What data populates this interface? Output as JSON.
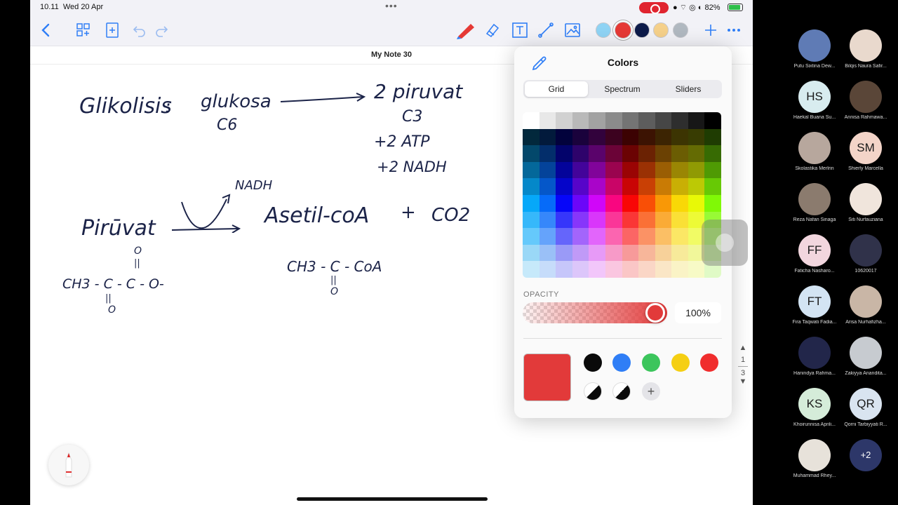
{
  "status_bar": {
    "time": "10.11",
    "date": "Wed 20 Apr",
    "battery": "82%"
  },
  "toolbar": {
    "left_icons": [
      "chevron-left-icon",
      "thumbnails-icon",
      "add-page-icon",
      "undo-icon",
      "redo-icon"
    ],
    "tool_icons": [
      "pen-icon",
      "eraser-icon",
      "text-icon",
      "lasso-icon",
      "image-icon"
    ],
    "pen_colors": [
      "#8fd3f4",
      "#e53935",
      "#0d1b4a",
      "#f5d08a",
      "#b0b8c0"
    ],
    "right_icons": [
      "plus-icon",
      "more-icon"
    ]
  },
  "note": {
    "title": "My Note 30",
    "handwriting": {
      "glikolisis": "Glikolisis",
      "colon": ":",
      "glukosa": "glukosa",
      "c6": "C6",
      "piruvat2": "2 piruvat",
      "c3": "C3",
      "atp": "+2 ATP",
      "nadh2": "+2 NADH",
      "nadh": "NADH",
      "piruvat": "Pirūvat",
      "asetil": "Asetil-coA",
      "plus": "+",
      "co2": "CO2",
      "formula_piruvat": "CH3 - C - C - O-",
      "formula_piruvat_o_top": "O",
      "formula_piruvat_o_bottom": "O",
      "formula_asetil": "CH3 - C - CoA",
      "formula_asetil_o": "O"
    }
  },
  "page_control": {
    "current": "1",
    "total": "3"
  },
  "colors_panel": {
    "title": "Colors",
    "tabs": [
      "Grid",
      "Spectrum",
      "Sliders"
    ],
    "active_tab": "Grid",
    "opacity_label": "OPACITY",
    "opacity_value": "100%",
    "current_color": "#e23a3a",
    "swatches": [
      "#0a0a0a",
      "#2f7ef6",
      "#3cc55c",
      "#f5cf13",
      "#f02d2d"
    ]
  },
  "participants": [
    {
      "name": "Putu Sixtina Dew...",
      "initials": "",
      "color": "#5f7bb5"
    },
    {
      "name": "Bilqis Naura Safir...",
      "initials": "",
      "color": "#e9d9cd"
    },
    {
      "name": "Haekal Buana Su...",
      "initials": "HS",
      "color": "#d8ecef"
    },
    {
      "name": "Annisa Rahmawa...",
      "initials": "",
      "color": "#5a4638"
    },
    {
      "name": "Skolastika Merlrin",
      "initials": "",
      "color": "#b7a79d"
    },
    {
      "name": "Shierly Marcella",
      "initials": "SM",
      "color": "#f3d4c8"
    },
    {
      "name": "Reza Nafan Sinaga",
      "initials": "",
      "color": "#8b7b6e"
    },
    {
      "name": "Siti Nurfauziana",
      "initials": "",
      "color": "#f0e5dc"
    },
    {
      "name": "Faticha Nasharo...",
      "initials": "FF",
      "color": "#f2d6de"
    },
    {
      "name": "10620017",
      "initials": "",
      "color": "#30324a"
    },
    {
      "name": "Fira Taqwati Fadia...",
      "initials": "FT",
      "color": "#d3e4f3"
    },
    {
      "name": "Arisa Nurhafizha...",
      "initials": "",
      "color": "#c9b6a6"
    },
    {
      "name": "Hanindya Rahma...",
      "initials": "",
      "color": "#22264a"
    },
    {
      "name": "Zakiyya Anandita...",
      "initials": "",
      "color": "#c7cbd0"
    },
    {
      "name": "Khoirunnisa Aprili...",
      "initials": "KS",
      "color": "#d5ecd9"
    },
    {
      "name": "Qorni Tarbiyyati R...",
      "initials": "QR",
      "color": "#d9e4f0"
    },
    {
      "name": "Muhammad Rhey...",
      "initials": "",
      "color": "#e7e2da"
    },
    {
      "name": "",
      "initials": "+2",
      "color": "#2d3769"
    }
  ]
}
